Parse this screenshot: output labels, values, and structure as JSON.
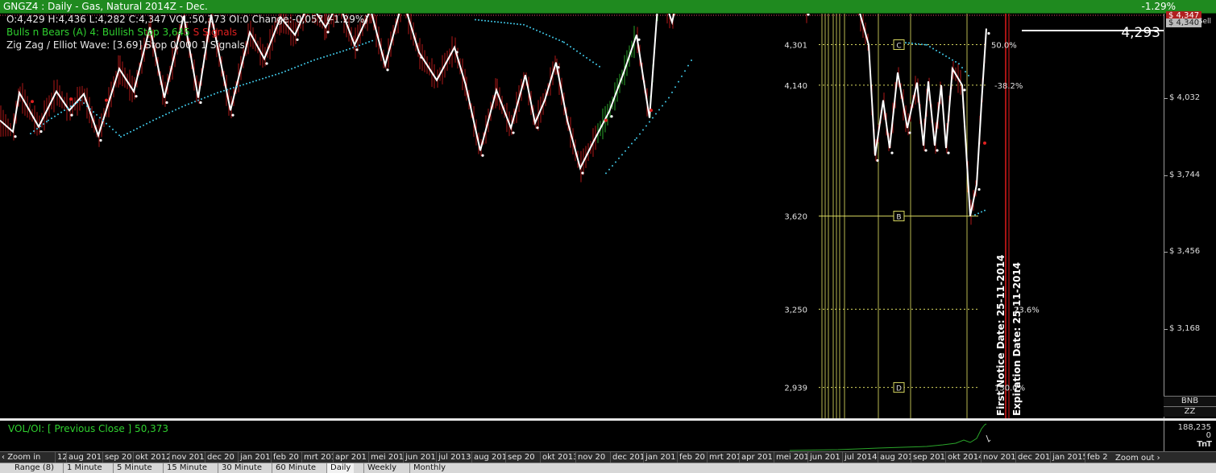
{
  "window": {
    "title": "GNGZ4 : Daily  -  Gas, Natural 2014Z - Dec.",
    "change_pct": "-1.29%"
  },
  "info": {
    "ohlc": "O:4,429  H:4,436  L:4,282  C:4,347  VOL:50,373  OI:0  Change:-0,057 (-1.29%)",
    "bulls_text": "Bulls n Bears (A) 4: Bullish  Stop 3,645",
    "bulls_signals": "S  Signals",
    "zigzag": "Zig Zag / Elliot Wave: [3.69]  Stop 0,000  1  Signals"
  },
  "price_axis": {
    "ticks": [
      "$ 4,032",
      "$ 3,744",
      "$ 3,456",
      "$ 3,168"
    ],
    "close_tag": "$ 4,347",
    "sell_tag": "$ 4,340",
    "sell_label": "Sell",
    "cursor_value": "4,293"
  },
  "fib_levels": {
    "values": [
      "4,301",
      "4,140",
      "3,620",
      "3,250",
      "2,939"
    ],
    "pct_50": "50.0%",
    "pct_382": "-38.2%",
    "pct_150": "150.0%",
    "pct_partial": "23.6%",
    "pt_c": "C",
    "pt_b": "B",
    "pt_d": "D"
  },
  "markers": {
    "first_notice": "First Notice Date: 25-11-2014",
    "expiration": "Expiration Date: 25-11-2014"
  },
  "side_buttons": {
    "bnb": "BNB",
    "zz": "ZZ"
  },
  "volume": {
    "label": "VOL/OI:",
    "prev_close": "[ Previous Close ] 50,373",
    "axis_top": "188,235",
    "axis_bottom": "0",
    "logo": "TnT"
  },
  "date_axis": {
    "labels": [
      "12",
      "aug 201",
      "sep 20",
      "okt 2012",
      "nov 201",
      "dec 20",
      "jan 201",
      "feb 20",
      "mrt 201",
      "apr 201",
      "mei 201",
      "jun 201",
      "jul 2013",
      "aug 201",
      "sep 20",
      "okt 2013",
      "nov 20",
      "dec 201",
      "jan 201",
      "feb 20",
      "mrt 201",
      "apr 201",
      "mei 201",
      "jun 201",
      "jul 2014",
      "aug 201",
      "sep 201",
      "okt 2014",
      "nov 201",
      "dec 201",
      "jan 2015",
      "feb 2"
    ],
    "zoom_in": "Zoom in",
    "zoom_out": "Zoom out"
  },
  "timeframes": {
    "range": "Range (8)",
    "items": [
      "1 Minute",
      "5 Minute",
      "15 Minute",
      "30 Minute",
      "60 Minute",
      "Daily",
      "Weekly",
      "Monthly"
    ],
    "active": "Daily"
  },
  "colors": {
    "titlebar": "#1f8a1f",
    "down_bar": "#b01818",
    "up_bar": "#2aa52a",
    "zigzag": "#ffffff",
    "stop_dots": "#40c8e8",
    "fib_line": "#d8d860",
    "marker_line": "#e01a1a"
  },
  "chart_data": {
    "type": "line",
    "title": "GNGZ4 : Daily  -  Gas, Natural 2014Z - Dec.",
    "xlabel": "",
    "ylabel": "",
    "ylim": [
      2810,
      4440
    ],
    "grid": false,
    "series": [
      {
        "name": "Zig Zag / Elliot Wave",
        "x": [
          0,
          16,
          24,
          48,
          70,
          86,
          104,
          122,
          148,
          166,
          186,
          204,
          228,
          246,
          262,
          286,
          310,
          328,
          348,
          366,
          384,
          404,
          420,
          440,
          460,
          478,
          500,
          520,
          542,
          564,
          578,
          596,
          616,
          634,
          652,
          664,
          676,
          690,
          704,
          720,
          738,
          756,
          774,
          790,
          806,
          818,
          834,
          852,
          870,
          888,
          904,
          922,
          944,
          962,
          982,
          1000,
          1014,
          1022,
          1046,
          1064,
          1078,
          1086,
          1096,
          1104,
          1114,
          1126,
          1138,
          1146,
          1152,
          1160,
          1168,
          1174,
          1182,
          1194,
          1204,
          1212,
          1218,
          1224
        ],
        "values": [
          4000,
          3955,
          4110,
          3975,
          4115,
          4040,
          4105,
          3940,
          4205,
          4115,
          4370,
          4090,
          4415,
          4090,
          4420,
          4040,
          4350,
          4245,
          4410,
          4340,
          4470,
          4370,
          4470,
          4300,
          4440,
          4220,
          4480,
          4270,
          4160,
          4290,
          4140,
          3880,
          4120,
          3970,
          4180,
          3990,
          4080,
          4230,
          4000,
          3810,
          3925,
          4035,
          4190,
          4340,
          4010,
          4540,
          4390,
          4650,
          4550,
          4700,
          4600,
          4780,
          4600,
          4720,
          4560,
          4440,
          4560,
          4680,
          4540,
          4460,
          4300,
          3860,
          4080,
          3890,
          4190,
          3970,
          4150,
          3900,
          4155,
          3900,
          4140,
          3890,
          4205,
          4140,
          3620,
          3745,
          4070,
          4365
        ]
      },
      {
        "name": "Bulls n Bears Stop",
        "x": [
          38,
          60,
          80,
          100,
          150,
          190,
          230,
          270,
          310,
          350,
          390,
          430,
          465,
          590,
          650,
          700,
          748,
          752,
          790,
          830,
          862,
          1120,
          1150,
          1190,
          1204,
          1210,
          1224
        ],
        "values": [
          3948,
          4000,
          4040,
          4080,
          3935,
          4000,
          4060,
          4110,
          4150,
          4190,
          4240,
          4280,
          4320,
          4400,
          4380,
          4310,
          4205,
          3790,
          3930,
          4090,
          4260,
          4310,
          4300,
          4225,
          4170,
          3625,
          3645
        ]
      }
    ],
    "fib_levels": [
      4301,
      4140,
      3620,
      3250,
      2939
    ],
    "markers": [
      "First Notice Date: 25-11-2014",
      "Expiration Date: 25-11-2014"
    ]
  }
}
